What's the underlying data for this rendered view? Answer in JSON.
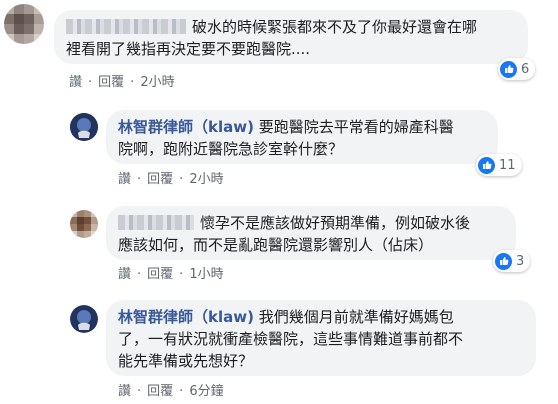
{
  "colors": {
    "link": "#385898",
    "bubble": "#f2f3f5",
    "meta": "#606770",
    "like": "#1877f2"
  },
  "comments": [
    {
      "author": "",
      "text": "破水的時候緊張都來不及了你最好還會在哪裡看開了幾指再決定要不要跑醫院....",
      "line1": "破水的時候緊張都來不及了你最好還會在哪",
      "line2": "裡看開了幾指再決定要不要跑醫院....",
      "like_label": "讚",
      "reply_label": "回覆",
      "time": "2小時",
      "reactions": "6",
      "reaction_icon": "like-icon"
    },
    {
      "author": "林智群律師（klaw)",
      "line1": "要跑醫院去平常看的婦產科醫",
      "line2": "院啊，跑附近醫院急診室幹什麼？",
      "like_label": "讚",
      "reply_label": "回覆",
      "time": "2小時",
      "reactions": "11",
      "reaction_icon": "like-icon"
    },
    {
      "author": "",
      "line1": "懷孕不是應該做好預期準備，例如破水後",
      "line2": "應該如何，而不是亂跑醫院還影響別人（佔床）",
      "like_label": "讚",
      "reply_label": "回覆",
      "time": "1小時",
      "reactions": "3",
      "reaction_icon": "like-icon"
    },
    {
      "author": "林智群律師（klaw)",
      "line1": "我們幾個月前就準備好媽媽包",
      "line2": "了，一有狀況就衝產檢醫院，這些事情難道事前都不",
      "line3": "能先準備或先想好？",
      "like_label": "讚",
      "reply_label": "回覆",
      "time": "6分鐘"
    }
  ]
}
